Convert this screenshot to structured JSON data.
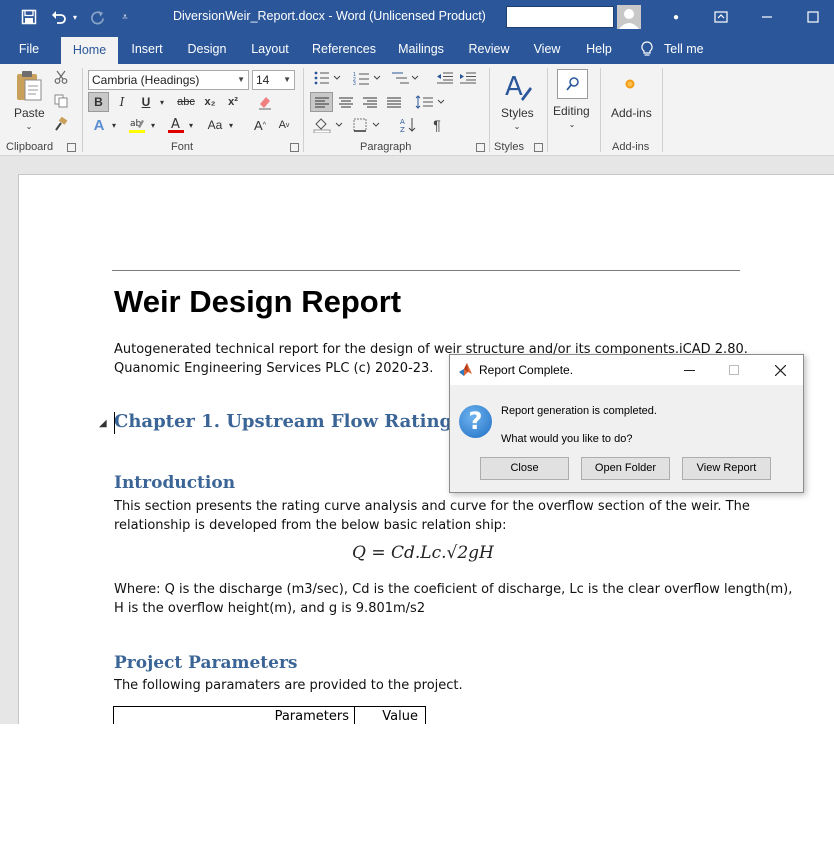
{
  "titlebar": {
    "doc_title": "DiversionWeir_Report.docx  -  Word (Unlicensed Product)",
    "save_icon": "save-icon",
    "undo_icon": "undo-icon",
    "redo_icon": "redo-icon",
    "customize_icon": "customize-qat-icon"
  },
  "menu": {
    "tabs": [
      "File",
      "Home",
      "Insert",
      "Design",
      "Layout",
      "References",
      "Mailings",
      "Review",
      "View",
      "Help"
    ],
    "active_tab": "Home",
    "tell_me": "Tell me"
  },
  "ribbon": {
    "clipboard": {
      "label": "Clipboard",
      "paste": "Paste"
    },
    "font": {
      "label": "Font",
      "font_name": "Cambria (Headings)",
      "font_size": "14",
      "bold": "B",
      "italic": "I",
      "underline": "U",
      "strike": "abc",
      "subscript": "x₂",
      "superscript": "x²",
      "change_case": "Aa",
      "grow": "A",
      "shrink": "A"
    },
    "paragraph": {
      "label": "Paragraph",
      "pilcrow": "¶"
    },
    "styles": {
      "label": "Styles",
      "button": "Styles"
    },
    "editing": {
      "button": "Editing"
    },
    "addins": {
      "label": "Add-ins",
      "button": "Add-ins"
    }
  },
  "document": {
    "title": "Weir Design Report",
    "intro_line1": "Autogenerated technical report for the design of weir structure and/or its components.iCAD 2.80.",
    "intro_line2": "Quanomic Engineering Services PLC (c) 2020-23.",
    "chapter1": "Chapter 1. Upstream Flow Rating",
    "introduction_heading": "Introduction",
    "intro_para1": "This section presents the rating curve analysis and curve for the overflow section of the weir. The",
    "intro_para2": "relationship is developed from the below basic relation ship:",
    "formula": "Q =  Cd.Lc.√2gH",
    "where_line1": "Where: Q is the discharge (m3/sec), Cd is the coeficient of discharge, Lc is the clear overflow length(m),",
    "where_line2": "H is the overflow height(m), and g is 9.801m/s2",
    "params_heading": "Project Parameters",
    "params_text": "The following paramaters are provided to the project.",
    "table_headers": [
      "Parameters",
      "Value"
    ]
  },
  "dialog": {
    "title": "Report Complete.",
    "message1": "Report generation is completed.",
    "message2": "What would you like to do?",
    "buttons": [
      "Close",
      "Open Folder",
      "View Report"
    ]
  },
  "colors": {
    "word_blue": "#2b579a",
    "heading_blue": "#3b6596",
    "ribbon_bg": "#f3f3f3",
    "canvas_bg": "#e6e6e6"
  }
}
